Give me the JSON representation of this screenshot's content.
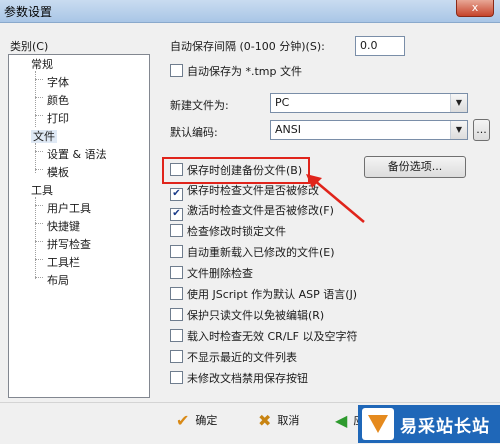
{
  "window": {
    "title": "参数设置",
    "close_label": "x"
  },
  "categories": {
    "label": "类别(C)",
    "items": [
      {
        "label": "常规"
      },
      {
        "label": "字体"
      },
      {
        "label": "颜色"
      },
      {
        "label": "打印"
      },
      {
        "label": "文件"
      },
      {
        "label": "设置 & 语法"
      },
      {
        "label": "模板"
      },
      {
        "label": "工具"
      },
      {
        "label": "用户工具"
      },
      {
        "label": "快捷键"
      },
      {
        "label": "拼写检查"
      },
      {
        "label": "工具栏"
      },
      {
        "label": "布局"
      }
    ]
  },
  "autosave": {
    "label": "自动保存间隔 (0-100 分钟)(S):",
    "value": "0.0"
  },
  "autosave_tmp": {
    "label": "自动保存为 *.tmp 文件",
    "checked": false
  },
  "new_file": {
    "label": "新建文件为:",
    "value": "PC"
  },
  "encoding": {
    "label": "默认编码:",
    "value": "ANSI",
    "more_label": "..."
  },
  "backup_options_label": "备份选项...",
  "options": [
    {
      "label": "保存时创建备份文件(B)",
      "checked": false
    },
    {
      "label": "保存时检查文件是否被修改",
      "checked": true
    },
    {
      "label": "激活时检查文件是否被修改(F)",
      "checked": true
    },
    {
      "label": "检查修改时锁定文件",
      "checked": false
    },
    {
      "label": "自动重新载入已修改的文件(E)",
      "checked": false
    },
    {
      "label": "文件删除检查",
      "checked": false
    },
    {
      "label": "使用 JScript 作为默认 ASP 语言(J)",
      "checked": false
    },
    {
      "label": "保护只读文件以免被编辑(R)",
      "checked": false
    },
    {
      "label": "载入时检查无效 CR/LF 以及空字符",
      "checked": false
    },
    {
      "label": "不显示最近的文件列表",
      "checked": false
    },
    {
      "label": "未修改文档禁用保存按钮",
      "checked": false
    }
  ],
  "footer": {
    "ok": "确定",
    "cancel": "取消",
    "apply_partial": "应"
  },
  "watermark": {
    "text": "易采站长站"
  },
  "colors": {
    "highlight": "#e0241b",
    "watermark_bg": "#1f67b8"
  }
}
